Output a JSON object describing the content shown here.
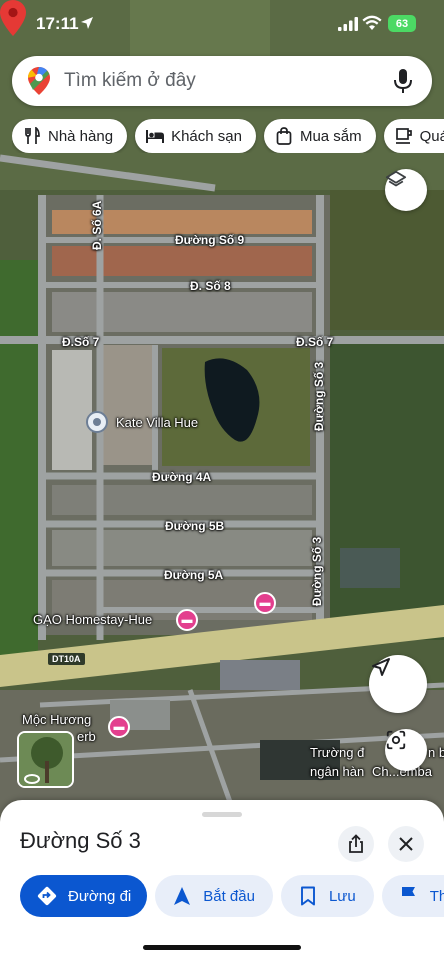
{
  "status_bar": {
    "time": "17:11",
    "battery": "63"
  },
  "search": {
    "placeholder": "Tìm kiếm ở đây"
  },
  "chips": [
    {
      "label": "Nhà hàng",
      "icon": "restaurant-icon"
    },
    {
      "label": "Khách sạn",
      "icon": "hotel-icon"
    },
    {
      "label": "Mua sắm",
      "icon": "shopping-bag-icon"
    },
    {
      "label": "Quán",
      "icon": "coffee-icon"
    }
  ],
  "map": {
    "road_labels": {
      "d_so_6a": "Đ. Số 6A",
      "duong_so_9": "Đường Số 9",
      "d_so_8": "Đ. Số 8",
      "d_so_7_left": "Đ.Số 7",
      "d_so_7_right": "Đ.Số 7",
      "duong_so_3_upper": "Đường Số 3",
      "duong_4a": "Đường 4A",
      "duong_5b": "Đường 5B",
      "duong_5a": "Đường 5A",
      "duong_so_3_lower": "Đường Số 3",
      "dt10a": "DT10A"
    },
    "places": {
      "kate_villa": "Kate Villa Hue",
      "gao_homestay": "GẠO Homestay-Hue",
      "moc_huong_line1": "Mộc Hương",
      "moc_huong_line2": "erb",
      "truong_line1": "Trường đ",
      "truong_line1b": "n b",
      "truong_line2": "ngân hàn",
      "truong_line2b": "Ch...emba"
    }
  },
  "sheet": {
    "title": "Đường Số 3",
    "actions": [
      {
        "label": "Đường đi",
        "icon": "directions-icon",
        "primary": true
      },
      {
        "label": "Bắt đầu",
        "icon": "navigation-icon",
        "primary": false
      },
      {
        "label": "Lưu",
        "icon": "bookmark-icon",
        "primary": false
      },
      {
        "label": "Thê",
        "icon": "flag-icon",
        "primary": false
      }
    ]
  },
  "colors": {
    "accent": "#0b57d0",
    "pin_red": "#e53935",
    "hotel_pink": "#e33f8e"
  }
}
